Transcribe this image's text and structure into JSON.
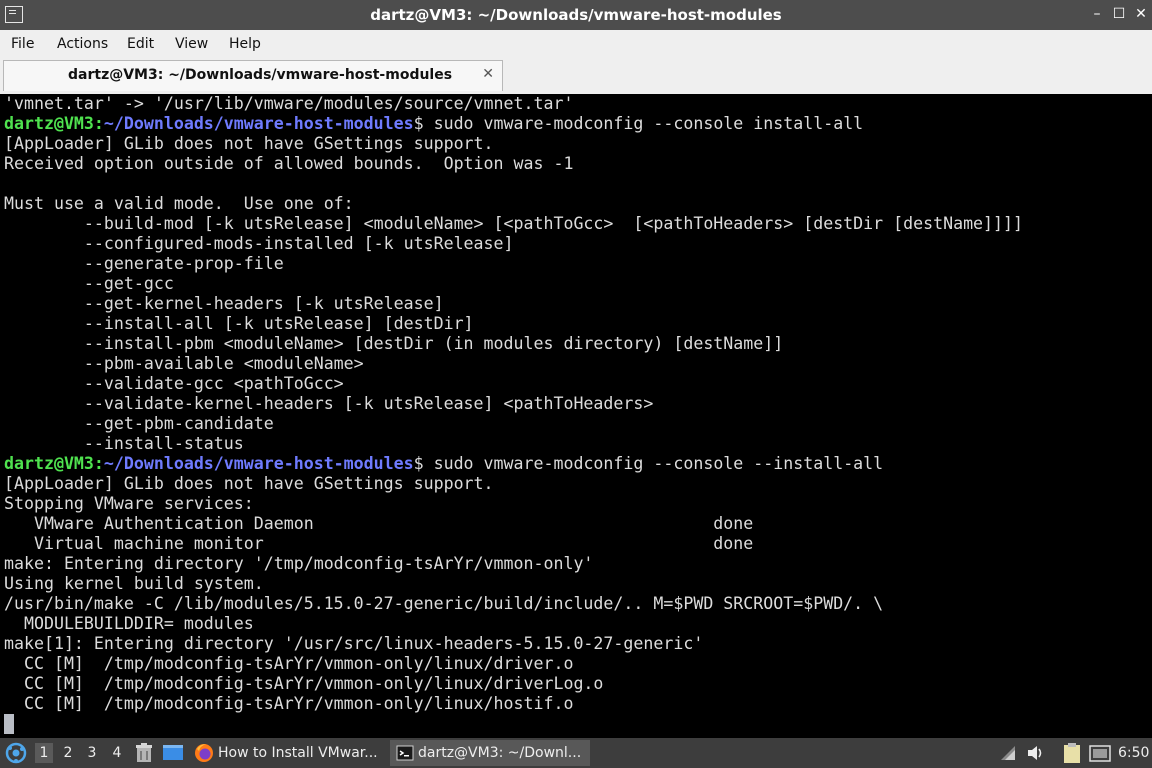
{
  "window": {
    "title": "dartz@VM3: ~/Downloads/vmware-host-modules",
    "controls": {
      "minimize": "–",
      "maximize": "☐",
      "close": "✕"
    }
  },
  "menu": {
    "file": "File",
    "actions": "Actions",
    "edit": "Edit",
    "view": "View",
    "help": "Help"
  },
  "tab": {
    "label": "dartz@VM3: ~/Downloads/vmware-host-modules",
    "close": "✕"
  },
  "colors": {
    "prompt_user": "#4fe24f",
    "prompt_path": "#6f7bff",
    "text": "#dcdcdc",
    "background": "#000000"
  },
  "terminal": {
    "prompt_user": "dartz@VM3:",
    "prompt_path": "~/Downloads/vmware-host-modules",
    "l0": "'vmnet.tar' -> '/usr/lib/vmware/modules/source/vmnet.tar'",
    "cmd1": "$ sudo vmware-modconfig --console install-all",
    "l2": "[AppLoader] GLib does not have GSettings support.",
    "l3": "Received option outside of allowed bounds.  Option was -1",
    "l5": "Must use a valid mode.  Use one of:",
    "l6": "        --build-mod [-k utsRelease] <moduleName> [<pathToGcc>  [<pathToHeaders> [destDir [destName]]]]",
    "l7": "        --configured-mods-installed [-k utsRelease]",
    "l8": "        --generate-prop-file",
    "l9": "        --get-gcc",
    "l10": "        --get-kernel-headers [-k utsRelease]",
    "l11": "        --install-all [-k utsRelease] [destDir]",
    "l12": "        --install-pbm <moduleName> [destDir (in modules directory) [destName]]",
    "l13": "        --pbm-available <moduleName>",
    "l14": "        --validate-gcc <pathToGcc>",
    "l15": "        --validate-kernel-headers [-k utsRelease] <pathToHeaders>",
    "l16": "        --get-pbm-candidate",
    "l17": "        --install-status",
    "cmd2": "$ sudo vmware-modconfig --console --install-all",
    "l19": "[AppLoader] GLib does not have GSettings support.",
    "l20": "Stopping VMware services:",
    "l21": "   VMware Authentication Daemon                                        done",
    "l22": "   Virtual machine monitor                                             done",
    "l23": "make: Entering directory '/tmp/modconfig-tsArYr/vmmon-only'",
    "l24": "Using kernel build system.",
    "l25": "/usr/bin/make -C /lib/modules/5.15.0-27-generic/build/include/.. M=$PWD SRCROOT=$PWD/. \\",
    "l26": "  MODULEBUILDDIR= modules",
    "l27": "make[1]: Entering directory '/usr/src/linux-headers-5.15.0-27-generic'",
    "l28": "  CC [M]  /tmp/modconfig-tsArYr/vmmon-only/linux/driver.o",
    "l29": "  CC [M]  /tmp/modconfig-tsArYr/vmmon-only/linux/driverLog.o",
    "l30": "  CC [M]  /tmp/modconfig-tsArYr/vmmon-only/linux/hostif.o"
  },
  "taskbar": {
    "desktops": [
      "1",
      "2",
      "3",
      "4"
    ],
    "firefox_task": "How to Install VMwar...",
    "terminal_task": "dartz@VM3: ~/Downl...",
    "clock": "6:50"
  }
}
